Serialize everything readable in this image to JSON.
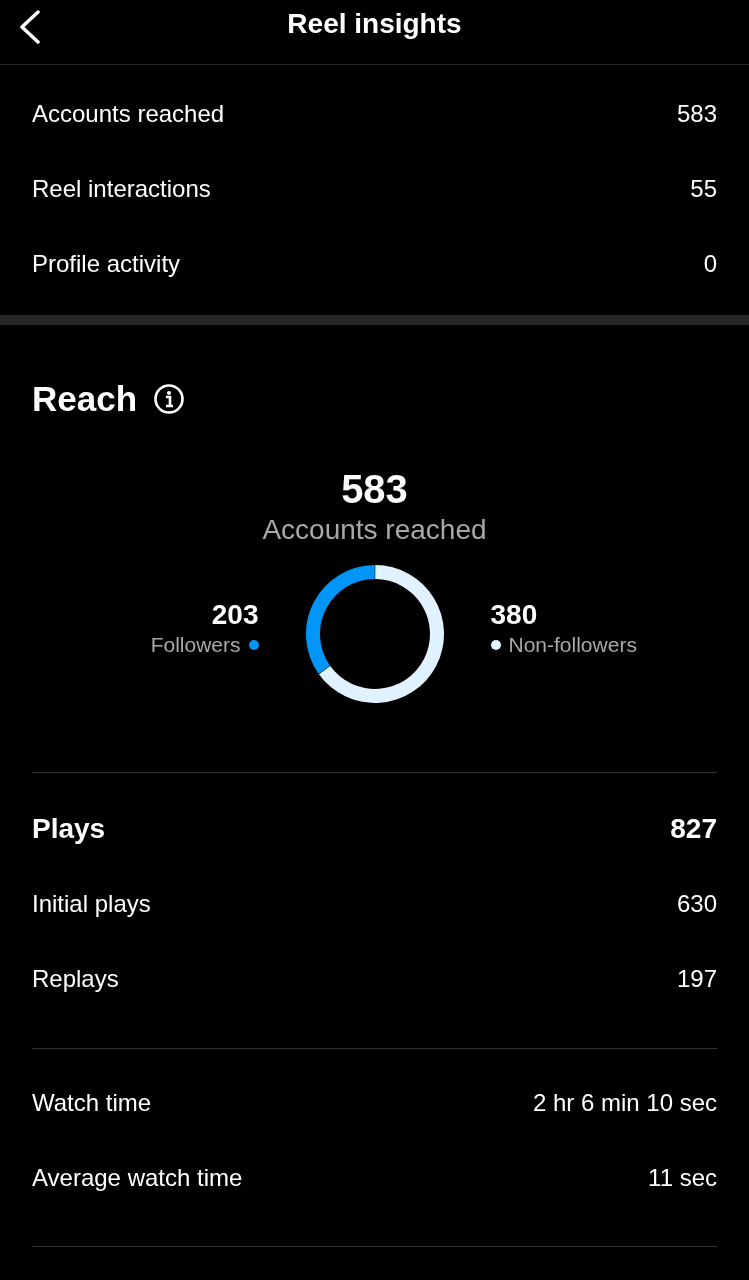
{
  "header": {
    "title": "Reel insights"
  },
  "overview": [
    {
      "label": "Accounts reached",
      "value": "583"
    },
    {
      "label": "Reel interactions",
      "value": "55"
    },
    {
      "label": "Profile activity",
      "value": "0"
    }
  ],
  "reach": {
    "title": "Reach",
    "total": "583",
    "total_label": "Accounts reached",
    "segments": [
      {
        "value": "203",
        "color": "#0095f6"
      },
      {
        "value": "380",
        "color": "#e0f1ff"
      }
    ],
    "chart_data": {
      "type": "donut",
      "categories": [
        "Followers",
        "Non-followers"
      ],
      "values": [
        34.82,
        65.18
      ]
    }
  },
  "plays": {
    "label": "Plays",
    "value": "827",
    "rows": [
      {
        "label": "Initial plays",
        "value": "630"
      },
      {
        "label": "Replays",
        "value": "197"
      }
    ]
  },
  "watch": [
    {
      "label": "Watch time",
      "value": "2 hr 6 min 10 sec"
    },
    {
      "label": "Average watch time",
      "value": "11 sec"
    }
  ]
}
